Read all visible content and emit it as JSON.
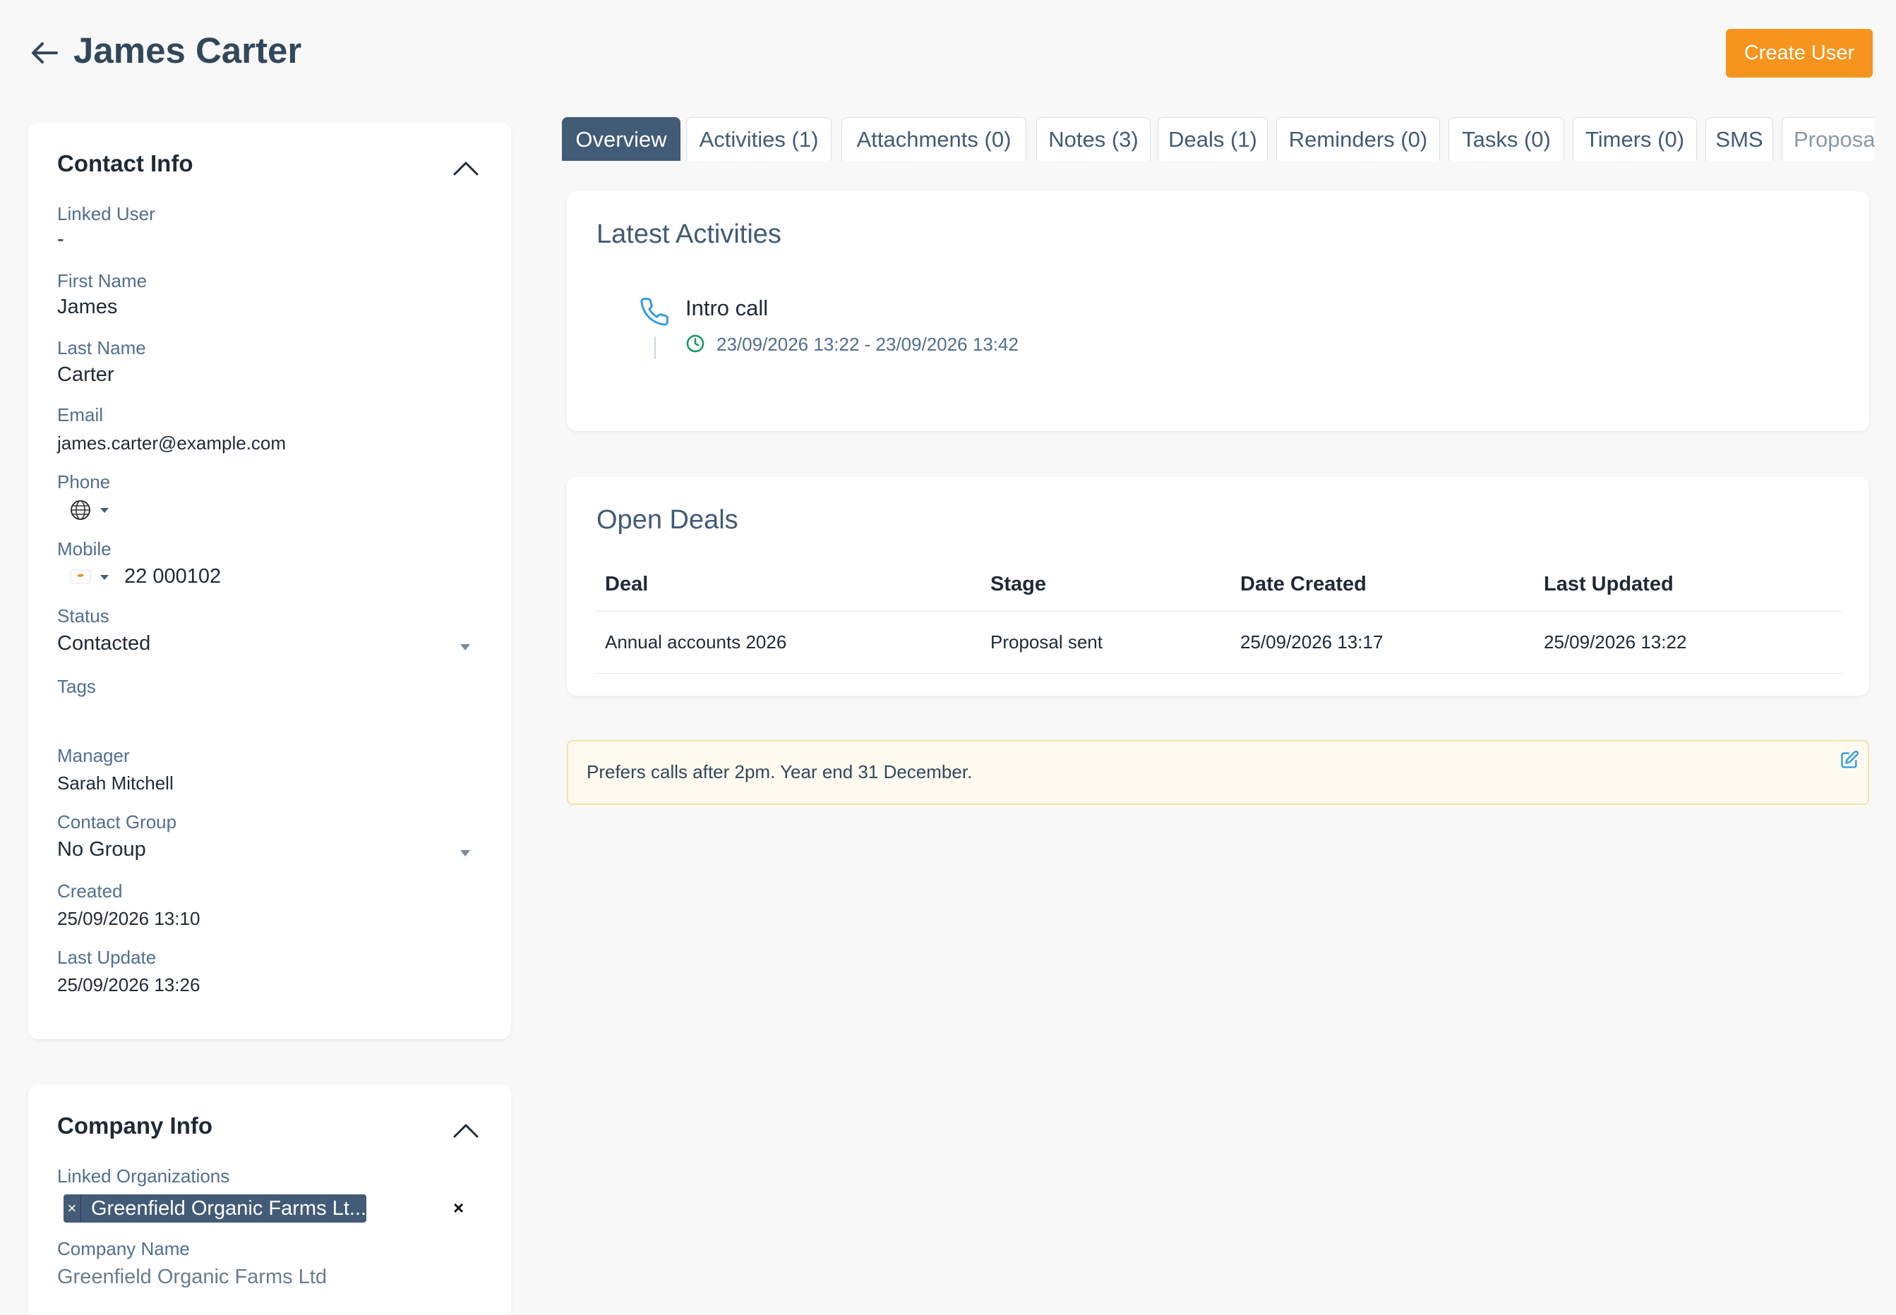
{
  "header": {
    "title": "James Carter",
    "create_button": "Create User"
  },
  "contact_info": {
    "title": "Contact Info",
    "fields": {
      "linked_user": {
        "label": "Linked User",
        "value": "-"
      },
      "first_name": {
        "label": "First Name",
        "value": "James"
      },
      "last_name": {
        "label": "Last Name",
        "value": "Carter"
      },
      "email": {
        "label": "Email",
        "value": "james.carter@example.com"
      },
      "phone": {
        "label": "Phone",
        "value": ""
      },
      "mobile": {
        "label": "Mobile",
        "value": "22 000102"
      },
      "status": {
        "label": "Status",
        "value": "Contacted"
      },
      "tags": {
        "label": "Tags",
        "value": ""
      },
      "manager": {
        "label": "Manager",
        "value": "Sarah Mitchell"
      },
      "contact_group": {
        "label": "Contact Group",
        "value": "No Group"
      },
      "created": {
        "label": "Created",
        "value": "25/09/2026 13:10"
      },
      "last_update": {
        "label": "Last Update",
        "value": "25/09/2026 13:26"
      }
    }
  },
  "company_info": {
    "title": "Company Info",
    "linked_orgs_label": "Linked Organizations",
    "linked_org_chip": "Greenfield Organic Farms Lt...",
    "chip_remove": "×",
    "clear_all": "×",
    "company_name_label": "Company Name",
    "company_name_placeholder": "Greenfield Organic Farms Ltd"
  },
  "tabs": [
    {
      "label": "Overview",
      "active": true
    },
    {
      "label": "Activities (1)"
    },
    {
      "label": "Attachments (0)"
    },
    {
      "label": "Notes (3)"
    },
    {
      "label": "Deals (1)"
    },
    {
      "label": "Reminders (0)"
    },
    {
      "label": "Tasks (0)"
    },
    {
      "label": "Timers (0)"
    },
    {
      "label": "SMS"
    },
    {
      "label": "Proposals"
    }
  ],
  "latest_activities": {
    "title": "Latest Activities",
    "items": [
      {
        "icon": "phone-icon",
        "title": "Intro call",
        "time": "23/09/2026 13:22 - 23/09/2026 13:42"
      }
    ]
  },
  "open_deals": {
    "title": "Open Deals",
    "columns": [
      "Deal",
      "Stage",
      "Date Created",
      "Last Updated"
    ],
    "rows": [
      [
        "Annual accounts 2026",
        "Proposal sent",
        "25/09/2026 13:17",
        "25/09/2026 13:22"
      ]
    ]
  },
  "note": {
    "text": "Prefers calls after 2pm. Year end 31 December."
  },
  "colors": {
    "accent": "#f7941d",
    "primary": "#425b76",
    "note_bg": "#fefaf0",
    "note_border": "#f5e3a6",
    "activity_icon": "#2e9be0",
    "clock_icon": "#1a9b5b"
  }
}
